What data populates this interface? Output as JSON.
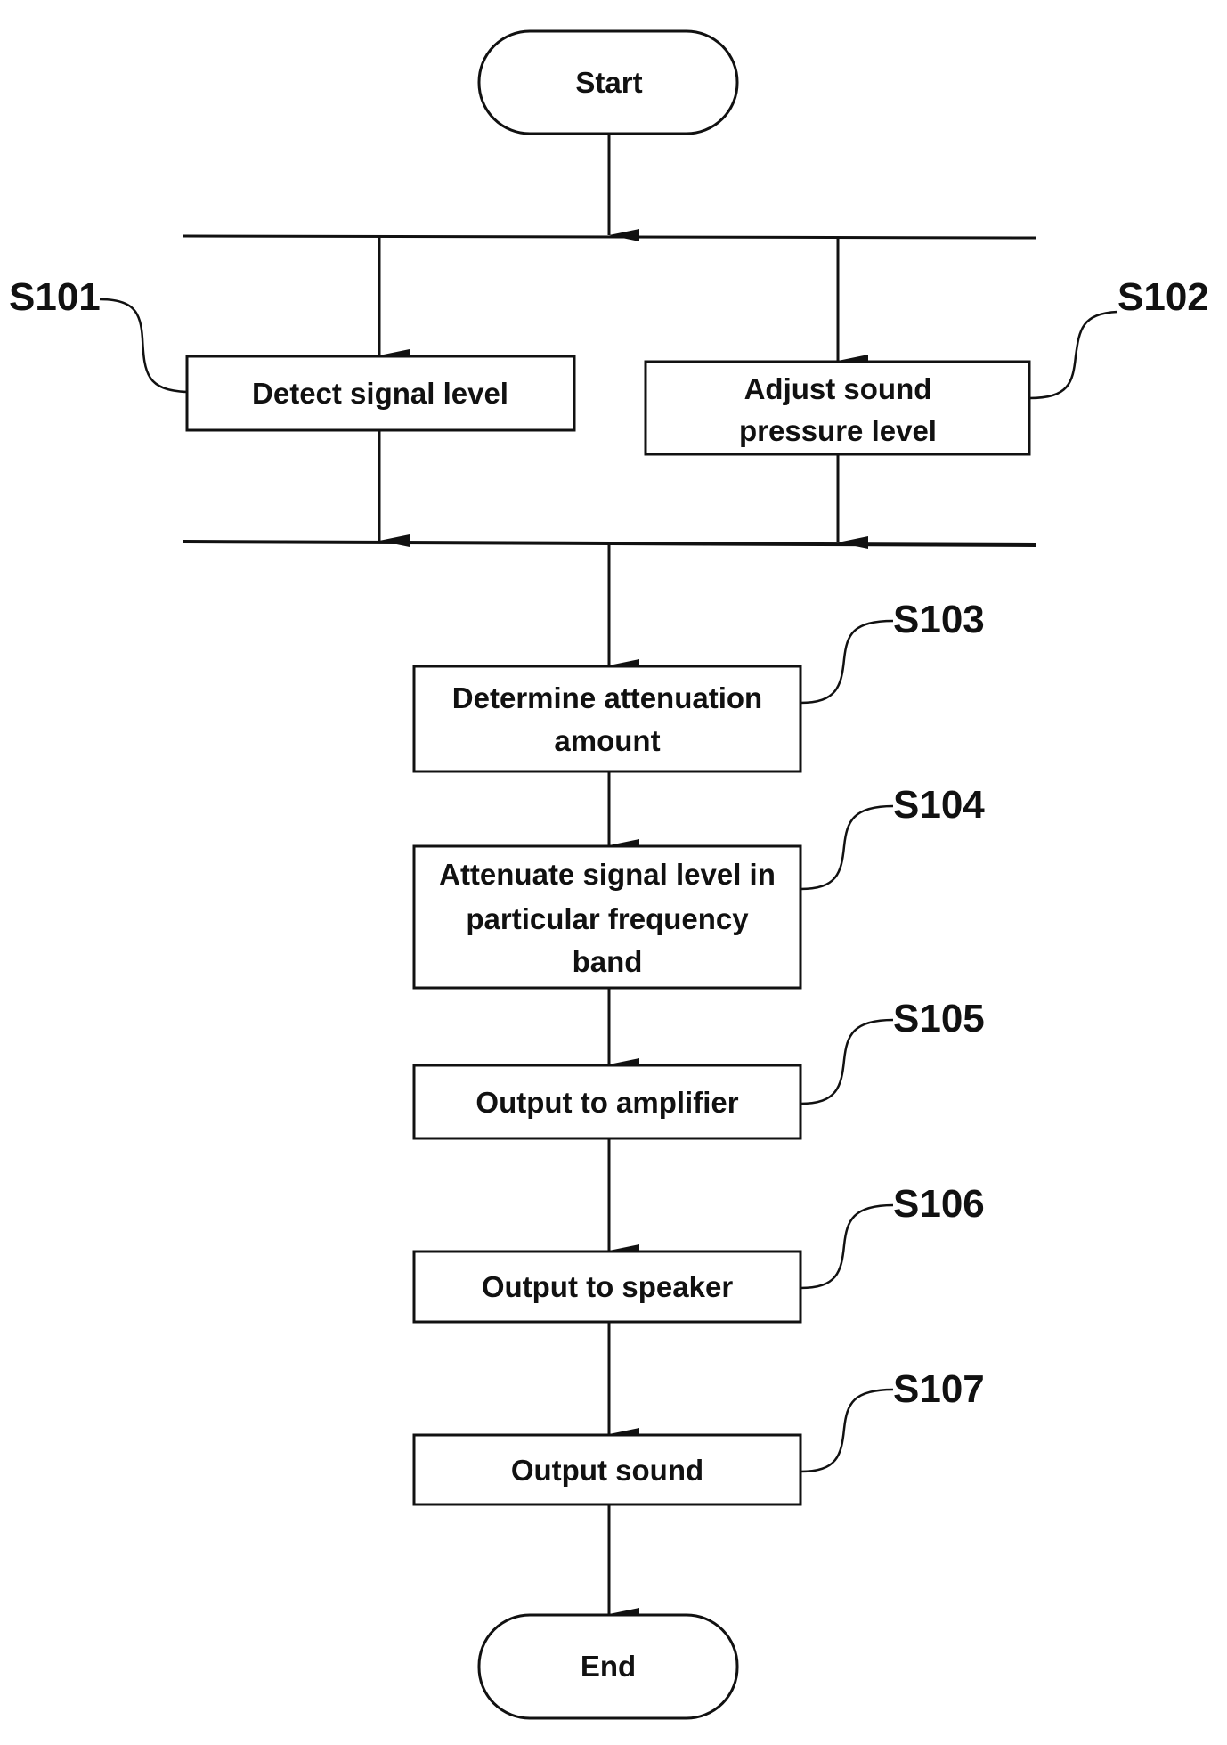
{
  "diagram": {
    "type": "flowchart",
    "start": {
      "label": "Start"
    },
    "end": {
      "label": "End"
    },
    "parallel_steps": [
      {
        "id": "S101",
        "label_lines": [
          "Detect signal level"
        ]
      },
      {
        "id": "S102",
        "label_lines": [
          "Adjust sound",
          "pressure level"
        ]
      }
    ],
    "sequential_steps": [
      {
        "id": "S103",
        "label_lines": [
          "Determine attenuation",
          "amount"
        ]
      },
      {
        "id": "S104",
        "label_lines": [
          "Attenuate signal level in",
          "particular frequency",
          "band"
        ]
      },
      {
        "id": "S105",
        "label_lines": [
          "Output to amplifier"
        ]
      },
      {
        "id": "S106",
        "label_lines": [
          "Output to speaker"
        ]
      },
      {
        "id": "S107",
        "label_lines": [
          "Output sound"
        ]
      }
    ],
    "colors": {
      "line": "#111111",
      "background": "#ffffff"
    }
  }
}
